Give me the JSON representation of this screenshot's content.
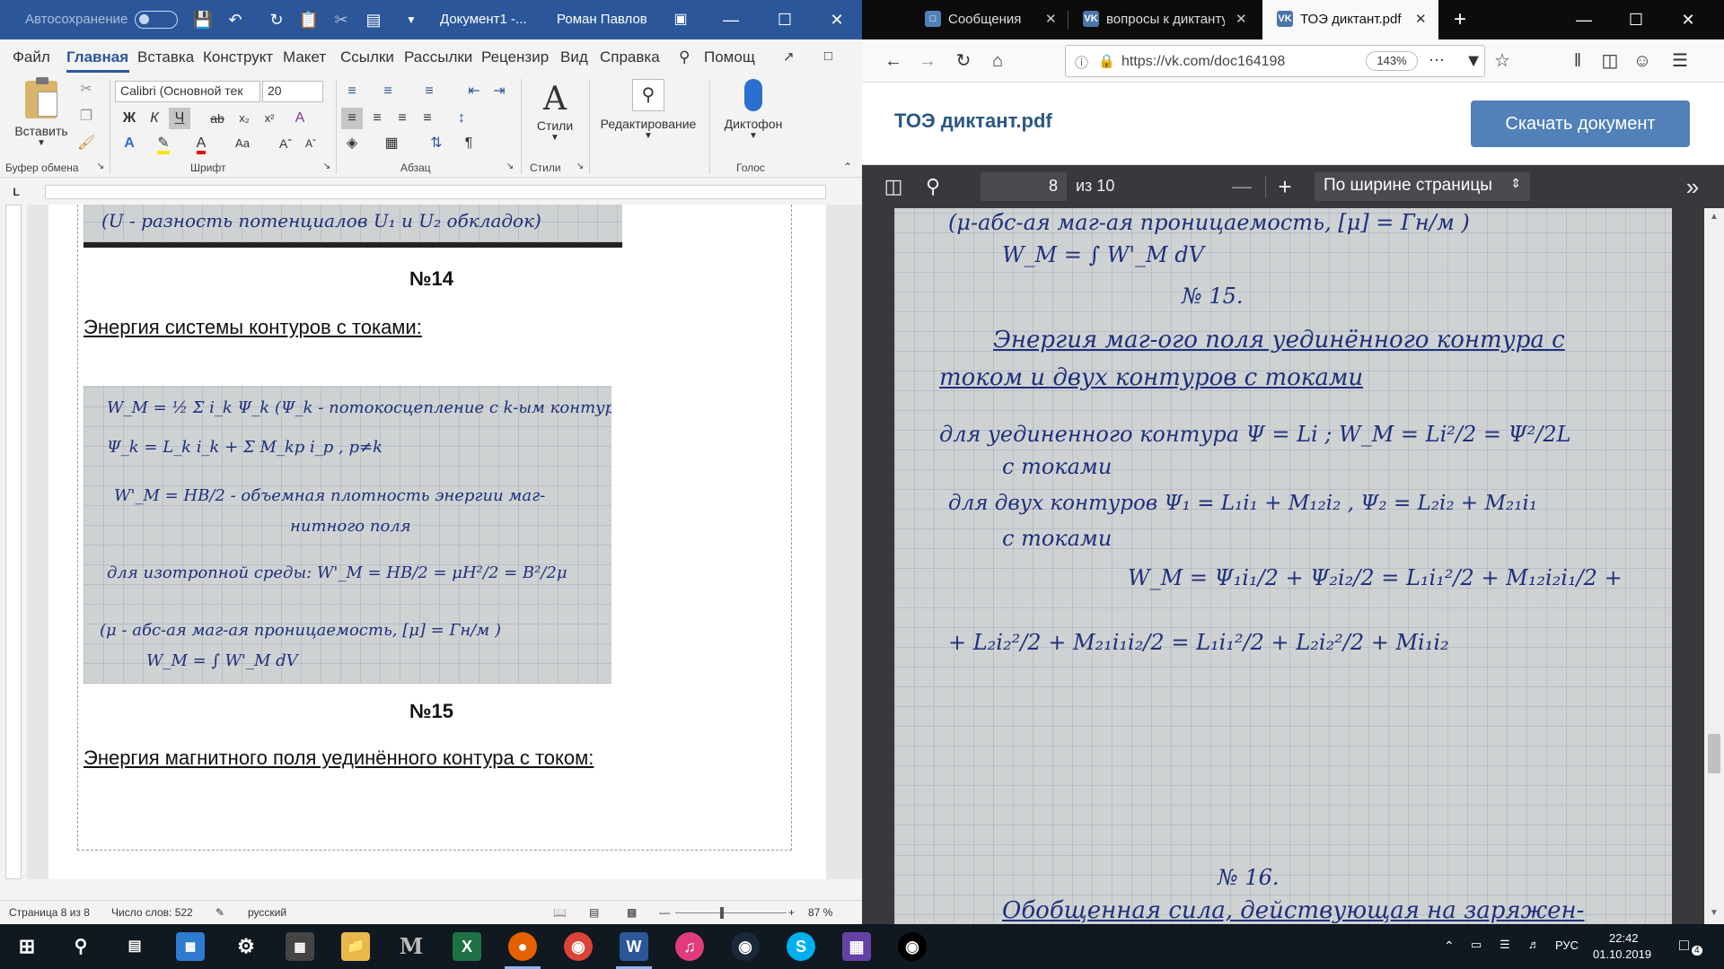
{
  "word": {
    "autosave_label": "Автосохранение",
    "doc_title": "Документ1 -...",
    "user": "Роман Павлов",
    "menu": [
      "Файл",
      "Главная",
      "Вставка",
      "Конструкт",
      "Макет",
      "Ссылки",
      "Рассылки",
      "Рецензир",
      "Вид",
      "Справка"
    ],
    "search_label": "Помощ",
    "ribbon": {
      "paste": "Вставить",
      "clipboard": "Буфер обмена",
      "font_name": "Calibri (Основной тек",
      "font_size": "20",
      "font": "Шрифт",
      "paragraph": "Абзац",
      "styles_btn": "Стили",
      "styles": "Стили",
      "editing": "Редактирование",
      "dictation": "Диктофон",
      "voice": "Голос"
    },
    "doc": {
      "prev_photo_text": "(U - разность потенциалов U₁ и U₂ обкладок)",
      "h14": "№14",
      "line14": "Энергия системы контуров с токами:",
      "photo_lines": [
        "W_M = ½ Σ i_k Ψ_k   (Ψ_k - потокосцепление с k-ым контуром)",
        "Ψ_k = L_k i_k + Σ M_kp i_p , p≠k",
        "W'_M = HB/2  - объемная плотность энергии маг-",
        "нитного поля",
        "для изотропной среды:  W'_M = HB/2 = μH²/2 = B²/2μ",
        "(μ - абс-ая маг-ая проницаемость, [μ] = Гн/м )",
        "W_M = ∫ W'_M dV"
      ],
      "h15": "№15",
      "line15": "Энергия магнитного поля уединённого контура с током:"
    },
    "status": {
      "page": "Страница 8 из 8",
      "words": "Число слов: 522",
      "lang": "русский",
      "zoom": "87 %"
    }
  },
  "firefox": {
    "tabs": [
      {
        "label": "Сообщения"
      },
      {
        "label": "вопросы к диктанту"
      },
      {
        "label": "ТОЭ диктант.pdf"
      }
    ],
    "url": "https://vk.com/doc164198",
    "zoom": "143%",
    "file_title": "ТОЭ диктант.pdf",
    "download": "Скачать документ",
    "page_current": "8",
    "page_of": "из 10",
    "zoom_mode": "По ширине страницы",
    "pdf_lines": [
      "(μ-абс-ая маг-ая проницаемость, [μ] = Гн/м )",
      "W_M = ∫ W'_M dV",
      "№ 15.",
      "Энергия маг-ого поля уединённого контура с",
      "током и двух контуров с токами",
      "для уединенного контура      Ψ = Li ;  W_M = Li²/2 = Ψ²/2L",
      "с токами",
      "для двух контуров      Ψ₁ = L₁i₁ + M₁₂i₂ , Ψ₂ = L₂i₂ + M₂₁i₁",
      "с токами",
      "W_M = Ψ₁i₁/2 + Ψ₂i₂/2 = L₁i₁²/2 + M₁₂i₂i₁/2 +",
      "+ L₂i₂²/2 + M₂₁i₁i₂/2 = L₁i₁²/2 + L₂i₂²/2 + Mi₁i₂"
    ],
    "pdf_next_lines": [
      "№ 16.",
      "Обобщенная сила, действующая на заряжен-"
    ]
  },
  "taskbar": {
    "lang": "РУС",
    "time": "22:42",
    "date": "01.10.2019",
    "notif_count": "4"
  },
  "colors": {
    "word_blue": "#2b579a",
    "vk_blue": "#5181b8",
    "ink": "#1f2f7a"
  }
}
